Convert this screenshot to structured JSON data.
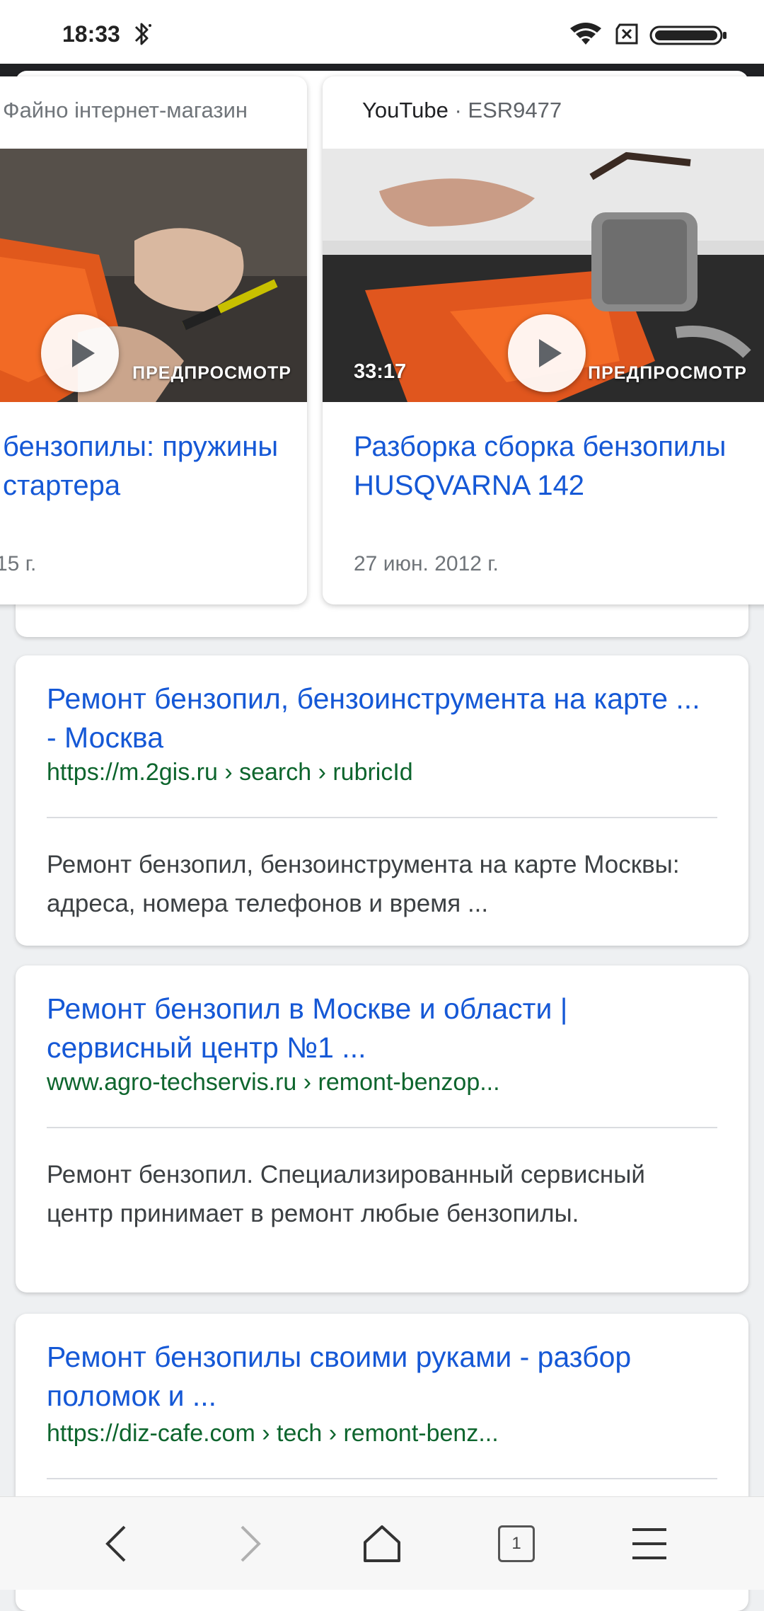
{
  "status_bar": {
    "time": "18:33",
    "icons": [
      "bluetooth-icon",
      "wifi-icon",
      "sim-none-icon",
      "battery-icon"
    ]
  },
  "carousel": {
    "cards": [
      {
        "source": "Файно інтернет-магазин",
        "preview_label": "ПРЕДПРОСМОТР",
        "title": "бензопилы: пружины стартера",
        "date": "15 г."
      },
      {
        "source_site": "YouTube",
        "source_sep": " · ",
        "source_author": "ESR9477",
        "duration": "33:17",
        "preview_label": "ПРЕДПРОСМОТР",
        "title": "Разборка сборка бензопилы HUSQVARNA 142",
        "date": "27 июн. 2012 г."
      }
    ]
  },
  "results": [
    {
      "title": "Ремонт бензопил, бензоинструмента на карте ... - Москва",
      "url": "https://m.2gis.ru › search › rubricId",
      "snippet": "Ремонт бензопил, бензоинструмента на карте Москвы: адреса, номера телефонов и время ..."
    },
    {
      "title": "Ремонт бензопил в Москве и области | сервисный центр №1 ...",
      "url": "www.agro-techservis.ru › remont-benzop...",
      "snippet": "Ремонт бензопил. Специализированный сервисный центр принимает в ремонт любые бензопилы."
    },
    {
      "title": "Ремонт бензопилы своими руками - разбор поломок и ...",
      "url": "https://diz-cafe.com › tech › remont-benz..."
    }
  ],
  "bottom_nav": {
    "tab_count": "1",
    "icons": [
      "back-arrow-icon",
      "forward-arrow-icon",
      "home-icon",
      "tabs-icon",
      "menu-icon"
    ]
  },
  "colors": {
    "link": "#1558d6",
    "url_green": "#0d652d",
    "snippet": "#3c4043",
    "appbar": "#202124"
  }
}
